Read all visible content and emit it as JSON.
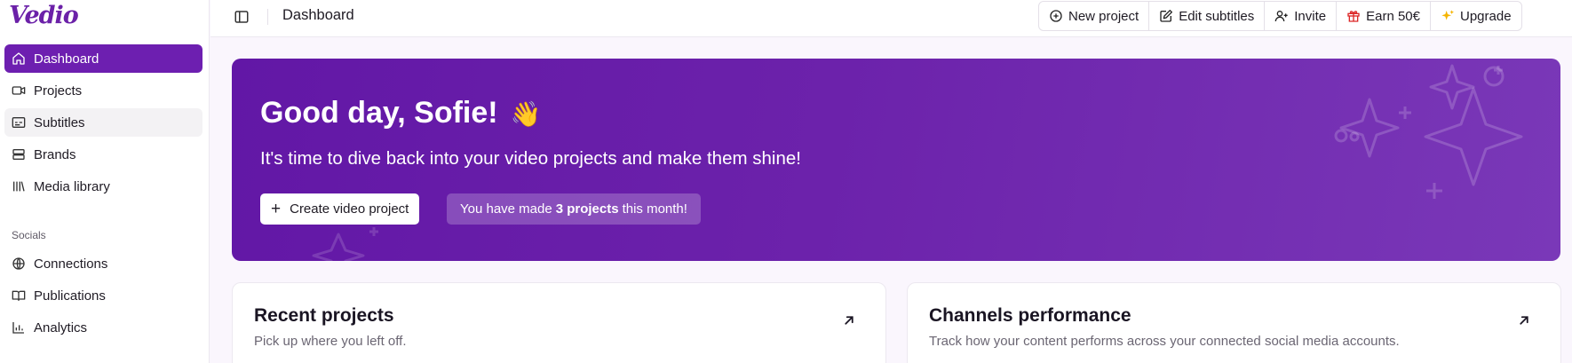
{
  "brand": {
    "name": "Vedio"
  },
  "sidebar": {
    "items": [
      {
        "label": "Dashboard",
        "icon": "home-icon"
      },
      {
        "label": "Projects",
        "icon": "video-icon"
      },
      {
        "label": "Subtitles",
        "icon": "subtitles-icon"
      },
      {
        "label": "Brands",
        "icon": "layers-icon"
      },
      {
        "label": "Media library",
        "icon": "library-icon"
      }
    ],
    "socials_label": "Socials",
    "social_items": [
      {
        "label": "Connections",
        "icon": "globe-icon"
      },
      {
        "label": "Publications",
        "icon": "book-open-icon"
      },
      {
        "label": "Analytics",
        "icon": "bar-chart-icon"
      }
    ]
  },
  "header": {
    "title": "Dashboard",
    "actions": [
      {
        "label": "New project",
        "icon": "plus-circle-icon"
      },
      {
        "label": "Edit subtitles",
        "icon": "edit-icon"
      },
      {
        "label": "Invite",
        "icon": "user-plus-icon"
      },
      {
        "label": "Earn 50€",
        "icon": "gift-icon"
      },
      {
        "label": "Upgrade",
        "icon": "sparkle-icon"
      }
    ]
  },
  "hero": {
    "greeting": "Good day, Sofie!",
    "emoji": "👋",
    "subtitle": "It's time to dive back into your video projects and make them shine!",
    "create_label": "Create video project",
    "stat_prefix": "You have made",
    "stat_count": "3 projects",
    "stat_suffix": "this month!"
  },
  "cards": {
    "recent": {
      "title": "Recent projects",
      "subtitle": "Pick up where you left off."
    },
    "channels": {
      "title": "Channels performance",
      "subtitle": "Track how your content performs across your connected social media accounts."
    }
  },
  "colors": {
    "accent": "#6d1fb0",
    "gift": "#dc2626",
    "sparkle": "#f5b400"
  }
}
